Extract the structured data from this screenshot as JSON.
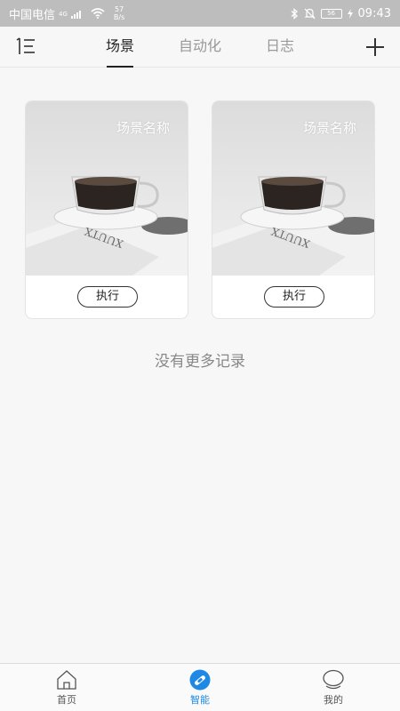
{
  "status_bar": {
    "carrier": "中国电信",
    "signal_type": "4G",
    "net_speed_value": "57",
    "net_speed_unit": "B/s",
    "battery_level": "56",
    "time": "09:43"
  },
  "header": {
    "tabs": [
      {
        "label": "场景",
        "active": true
      },
      {
        "label": "自动化",
        "active": false
      },
      {
        "label": "日志",
        "active": false
      }
    ]
  },
  "scenes": [
    {
      "title": "场景名称",
      "action_label": "执行"
    },
    {
      "title": "场景名称",
      "action_label": "执行"
    }
  ],
  "empty_message": "没有更多记录",
  "bottom_nav": {
    "items": [
      {
        "label": "首页",
        "icon": "home-icon",
        "active": false
      },
      {
        "label": "智能",
        "icon": "smart-icon",
        "active": true
      },
      {
        "label": "我的",
        "icon": "profile-icon",
        "active": false
      }
    ]
  },
  "colors": {
    "accent": "#1e88e5",
    "status_bar_bg": "#bdbdbd",
    "page_bg": "#f7f7f7"
  }
}
